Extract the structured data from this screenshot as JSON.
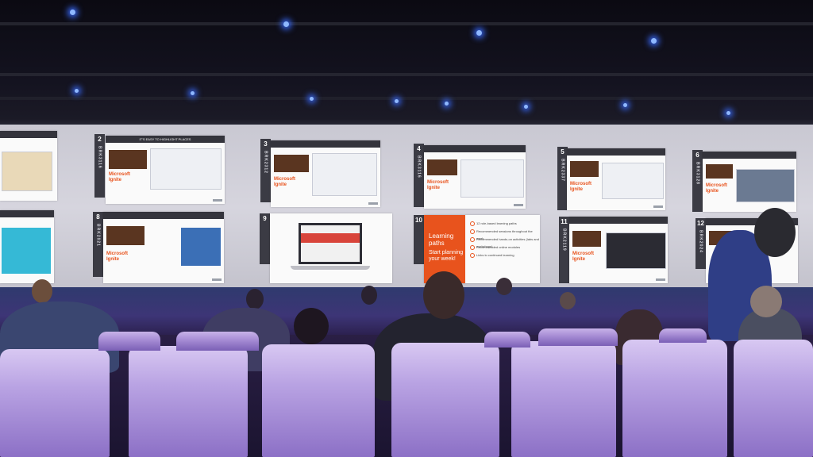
{
  "scene": {
    "description_labels": {
      "brand_line1": "Microsoft",
      "brand_line2": "Ignite"
    },
    "slides": [
      {
        "number": "",
        "code": "",
        "header": "",
        "title": ""
      },
      {
        "number": "2",
        "code": "BRK3116",
        "header": "IT'S EASY TO HIGHLIGHT PLACES",
        "title": ""
      },
      {
        "number": "3",
        "code": "BRK2312",
        "header": "",
        "title": ""
      },
      {
        "number": "4",
        "code": "BRK3116",
        "header": "",
        "title": ""
      },
      {
        "number": "5",
        "code": "BRK2337",
        "header": "",
        "title": ""
      },
      {
        "number": "6",
        "code": "BRK3128",
        "header": "",
        "title": ""
      },
      {
        "number": "",
        "code": "",
        "header": "",
        "title": ""
      },
      {
        "number": "8",
        "code": "BRK2021",
        "header": "",
        "title": ""
      },
      {
        "number": "9",
        "code": "",
        "header": "",
        "title": ""
      },
      {
        "number": "10",
        "code": "",
        "header": "",
        "title": ""
      },
      {
        "number": "11",
        "code": "BRK2119",
        "header": "",
        "title": ""
      },
      {
        "number": "12",
        "code": "BRK2024",
        "header": "",
        "title": ""
      }
    ],
    "learning_paths": {
      "title_line1": "Learning",
      "title_line2": "paths",
      "subtitle_line1": "Start planning",
      "subtitle_line2": "your week!",
      "items": [
        "12 role-based learning paths",
        "Recommended sessions throughout the week",
        "Recommended hands-on activities (labs and workshops)",
        "Recommended online modules",
        "Links to continued learning"
      ]
    },
    "colors": {
      "accent": "#e8531d",
      "seat": "#b9a3e3",
      "wall": "#d6d5de"
    }
  }
}
